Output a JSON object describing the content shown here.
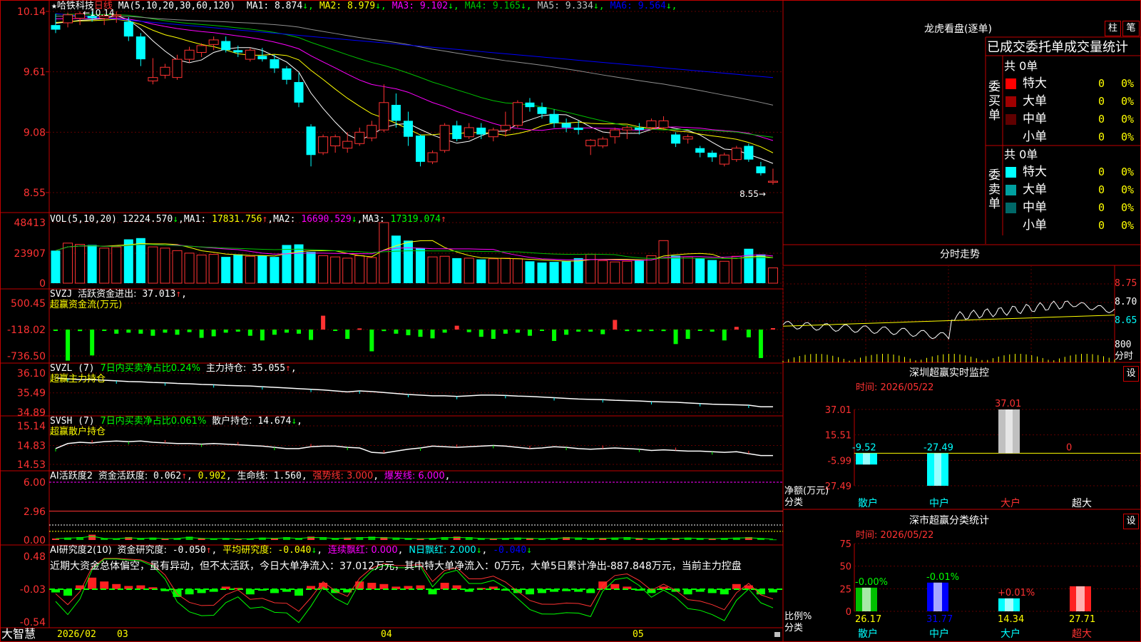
{
  "colors": {
    "up": "#ff3232",
    "down": "#00ffff",
    "frame": "#c00000",
    "ma1": "#ffffff",
    "ma2": "#ffff00",
    "ma3": "#ff00ff",
    "ma4": "#00c000",
    "ma5": "#909090",
    "ma6": "#0000ff"
  },
  "header": {
    "star": "★",
    "stock_name": "哈铁科技",
    "period": "日线",
    "ma_params": "MA(5,10,20,30,60,120)",
    "ma_items": [
      {
        "label": "MA1:",
        "value": "8.874",
        "arrow": "↓",
        "color": "#ffffff"
      },
      {
        "label": "MA2:",
        "value": "8.979",
        "arrow": "↓",
        "color": "#ffff00"
      },
      {
        "label": "MA3:",
        "value": "9.102",
        "arrow": "↓",
        "color": "#ff00ff"
      },
      {
        "label": "MA4:",
        "value": "9.165",
        "arrow": "↓",
        "color": "#00c000"
      },
      {
        "label": "MA5:",
        "value": "9.334",
        "arrow": "↓",
        "color": "#c0c0c0"
      },
      {
        "label": "MA6:",
        "value": "9.564",
        "arrow": "↓",
        "color": "#0000ff"
      }
    ],
    "max_label": "10.14",
    "min_label": "8.55",
    "price_ticks": [
      "10.14",
      "9.61",
      "9.08",
      "8.55"
    ]
  },
  "vol": {
    "title": "VOL(5,10,20)",
    "value": "12224.570",
    "arrow": "↓",
    "ma1": "17831.756",
    "ma1_arrow": "↑",
    "ma2": "16690.529",
    "ma2_arrow": "↓",
    "ma3": "17319.074",
    "ma3_arrow": "↑",
    "ticks": [
      "48413",
      "23907",
      "0"
    ]
  },
  "svzj": {
    "title": "SVZJ",
    "label": "活跃资金进出:",
    "value": "37.013",
    "arrow": "↑",
    "comma": ",",
    "sub": "超赢资金流(万元)",
    "ticks": [
      "500.45",
      "-118.02",
      "-736.50"
    ]
  },
  "svzl": {
    "title": "SVZL (7)",
    "label1": "7日内买卖净占比0.24%",
    "label2": "主力持仓:",
    "value": "35.055",
    "arrow": "↑",
    "comma": ",",
    "sub": "超赢主力持仓",
    "ticks": [
      "36.10",
      "35.49",
      "34.89"
    ]
  },
  "svsh": {
    "title": "SVSH (7)",
    "label1": "7日内买卖净占比0.061%",
    "label2": "散户持仓:",
    "value": "14.674",
    "arrow": "↓",
    "comma": ",",
    "sub": "超赢散户持仓",
    "ticks": [
      "15.14",
      "14.83",
      "14.53"
    ]
  },
  "ai1": {
    "title": "AI活跃度2",
    "label": "资金活跃度:",
    "v1": "0.062",
    "a1": "↑",
    "v2": "0.902",
    "life_label": "生命线:",
    "life": "1.560",
    "strong": "强势线: 3.000",
    "burst": "爆发线: 6.000",
    "ticks": [
      "6.00",
      "2.96",
      "0.00"
    ]
  },
  "ai2": {
    "title": "AI研究度2(10)",
    "label1": "资金研究度:",
    "v1": "-0.050",
    "a1": "↑",
    "label2": "平均研究度:",
    "v2": "-0.040",
    "a2": "↓",
    "label3": "连续飘红: 0.000",
    "label4": "N日飘红: 2.000",
    "a4": "↓",
    "v5": "-0.040",
    "a5": "↓",
    "comment": "近期大资金总体偏空，虽有异动，但不太活跃，今日大单净流入：37.012万元，其中特大单净流入：0万元，大单5日累计净出-887.848万元，当前主力控盘",
    "ticks": [
      "0.48",
      "-0.03",
      "-0.54"
    ]
  },
  "bottom": {
    "brand": "大智慧",
    "dates": [
      "2026/02",
      "03",
      "04",
      "05"
    ]
  },
  "right": {
    "dragon_title": "龙虎看盘(逐单)",
    "btn_bar": "柱",
    "btn_pen": "笔",
    "tabs": "已成交委托单成交量统计",
    "buy_label": "委买单",
    "sell_label": "委卖单",
    "buy_total": "共 0单",
    "sell_total": "共 0单",
    "buy_rows": [
      {
        "name": "特大",
        "count": "0",
        "pct": "0%",
        "color": "#ff0000"
      },
      {
        "name": "大单",
        "count": "0",
        "pct": "0%",
        "color": "#a00000"
      },
      {
        "name": "中单",
        "count": "0",
        "pct": "0%",
        "color": "#600000"
      },
      {
        "name": "小单",
        "count": "0",
        "pct": "0%",
        "color": ""
      }
    ],
    "sell_rows": [
      {
        "name": "特大",
        "count": "0",
        "pct": "0%",
        "color": "#00ffff"
      },
      {
        "name": "大单",
        "count": "0",
        "pct": "0%",
        "color": "#00a0a0"
      },
      {
        "name": "中单",
        "count": "0",
        "pct": "0%",
        "color": "#006868"
      },
      {
        "name": "小单",
        "count": "0",
        "pct": "0%",
        "color": ""
      }
    ],
    "intraday_title": "分时走势",
    "intraday_ticks": [
      "8.75",
      "8.70",
      "8.65"
    ],
    "intraday_vol": "800",
    "intraday_unit": "分时",
    "monitor_title": "深圳超赢实时监控",
    "monitor_time": "时间: 2026/05/22",
    "monitor_btn": "设",
    "monitor_ticks": [
      "37.01",
      "15.51",
      "-5.99",
      "-27.49"
    ],
    "monitor_ylabel": "净额(万元)",
    "monitor_xlabel": "分类",
    "stat_title": "深市超赢分类统计",
    "stat_time": "时间: 2026/05/22",
    "stat_btn": "设",
    "stat_ticks": [
      "75",
      "50",
      "25",
      "0"
    ],
    "stat_ylabel": "比例%",
    "stat_xlabel": "分类"
  },
  "chart_data": [
    {
      "type": "candlestick",
      "title": "哈铁科技 日线",
      "ylim": [
        8.55,
        10.14
      ],
      "min_label": 8.55,
      "max_label": 10.14,
      "ohlc": [
        [
          10.02,
          10.12,
          9.95,
          9.98
        ],
        [
          10.04,
          10.13,
          10.0,
          10.11
        ],
        [
          10.08,
          10.14,
          10.02,
          10.12
        ],
        [
          10.1,
          10.14,
          10.05,
          10.08
        ],
        [
          10.08,
          10.12,
          10.02,
          10.1
        ],
        [
          10.1,
          10.14,
          10.04,
          10.11
        ],
        [
          10.05,
          10.09,
          9.88,
          9.92
        ],
        [
          9.92,
          9.95,
          9.66,
          9.72
        ],
        [
          9.53,
          9.73,
          9.5,
          9.56
        ],
        [
          9.58,
          9.68,
          9.55,
          9.65
        ],
        [
          9.56,
          9.76,
          9.54,
          9.72
        ],
        [
          9.72,
          9.83,
          9.69,
          9.8
        ],
        [
          9.78,
          9.86,
          9.74,
          9.84
        ],
        [
          9.85,
          9.92,
          9.8,
          9.89
        ],
        [
          9.88,
          9.92,
          9.78,
          9.8
        ],
        [
          9.8,
          9.84,
          9.74,
          9.78
        ],
        [
          9.72,
          9.82,
          9.7,
          9.8
        ],
        [
          9.75,
          9.82,
          9.7,
          9.72
        ],
        [
          9.72,
          9.76,
          9.6,
          9.64
        ],
        [
          9.64,
          9.66,
          9.5,
          9.54
        ],
        [
          9.52,
          9.6,
          9.3,
          9.34
        ],
        [
          9.13,
          9.15,
          8.78,
          8.88
        ],
        [
          8.9,
          9.06,
          8.88,
          9.04
        ],
        [
          8.96,
          9.06,
          8.9,
          9.04
        ],
        [
          8.94,
          9.08,
          8.9,
          9.0
        ],
        [
          8.98,
          9.12,
          8.96,
          9.08
        ],
        [
          9.03,
          9.18,
          9.0,
          9.14
        ],
        [
          9.1,
          9.5,
          9.08,
          9.34
        ],
        [
          9.32,
          9.42,
          9.12,
          9.18
        ],
        [
          9.18,
          9.26,
          8.96,
          9.04
        ],
        [
          9.05,
          9.06,
          8.78,
          8.82
        ],
        [
          8.82,
          8.92,
          8.8,
          8.9
        ],
        [
          8.92,
          9.16,
          8.9,
          9.14
        ],
        [
          9.14,
          9.18,
          9.0,
          9.02
        ],
        [
          9.04,
          9.16,
          9.02,
          9.12
        ],
        [
          9.12,
          9.16,
          9.02,
          9.06
        ],
        [
          9.04,
          9.12,
          9.0,
          9.1
        ],
        [
          9.1,
          9.26,
          9.04,
          9.14
        ],
        [
          9.14,
          9.36,
          9.12,
          9.34
        ],
        [
          9.34,
          9.38,
          9.26,
          9.3
        ],
        [
          9.3,
          9.34,
          9.2,
          9.24
        ],
        [
          9.24,
          9.28,
          9.12,
          9.16
        ],
        [
          9.16,
          9.2,
          9.08,
          9.12
        ],
        [
          9.12,
          9.18,
          9.06,
          9.1
        ],
        [
          8.96,
          9.02,
          8.88,
          9.01
        ],
        [
          8.96,
          9.04,
          8.94,
          9.02
        ],
        [
          9.04,
          9.12,
          8.98,
          9.1
        ],
        [
          9.1,
          9.14,
          9.02,
          9.12
        ],
        [
          9.12,
          9.16,
          9.06,
          9.1
        ],
        [
          9.12,
          9.2,
          9.1,
          9.18
        ],
        [
          9.12,
          9.22,
          9.1,
          9.18
        ],
        [
          9.06,
          9.08,
          8.95,
          8.98
        ],
        [
          9.02,
          9.06,
          8.98,
          9.04
        ],
        [
          8.94,
          8.96,
          8.86,
          8.9
        ],
        [
          8.9,
          8.92,
          8.82,
          8.86
        ],
        [
          8.8,
          8.9,
          8.78,
          8.88
        ],
        [
          8.84,
          8.96,
          8.82,
          8.94
        ],
        [
          8.96,
          8.98,
          8.82,
          8.84
        ],
        [
          8.78,
          8.82,
          8.7,
          8.72
        ],
        [
          8.64,
          8.76,
          8.62,
          8.65
        ]
      ]
    },
    {
      "type": "bar",
      "title": "VOL(5,10,20)",
      "ylim": [
        0,
        48413
      ],
      "values": [
        26000,
        32000,
        31000,
        30500,
        28000,
        29000,
        35000,
        36000,
        29000,
        28000,
        26000,
        24000,
        22500,
        23000,
        21000,
        23000,
        21500,
        22000,
        21000,
        30500,
        31000,
        25000,
        22000,
        21000,
        20000,
        22000,
        20500,
        49000,
        38000,
        34000,
        28000,
        21000,
        21500,
        20000,
        20000,
        19000,
        19500,
        20000,
        19500,
        17500,
        16500,
        17000,
        17500,
        20000,
        23000,
        18000,
        17000,
        17500,
        18000,
        22000,
        34000,
        22000,
        21000,
        20000,
        18500,
        17500,
        21500,
        27500,
        23000,
        12224
      ]
    },
    {
      "type": "bar",
      "title": "SVZJ",
      "ylim": [
        -736.5,
        500.45
      ],
      "values": [
        -20,
        -600,
        -30,
        -500,
        -20,
        -80,
        -60,
        -80,
        -120,
        -60,
        -100,
        -50,
        -160,
        -130,
        -60,
        -40,
        -120,
        -210,
        -100,
        -60,
        -80,
        -200,
        360,
        -20,
        -180,
        30,
        -420,
        -30,
        -80,
        -110,
        -140,
        -170,
        -60,
        100,
        -50,
        -140,
        -180,
        -80,
        -60,
        -120,
        -20,
        -220,
        -100,
        -40,
        -40,
        -90,
        250,
        -30,
        -40,
        -30,
        -30,
        -280,
        -180,
        -20,
        -40,
        -210,
        70,
        -150,
        -550,
        37
      ]
    },
    {
      "type": "line",
      "title": "SVZL",
      "ylim": [
        34.89,
        36.1
      ],
      "values": [
        35.95,
        35.92,
        35.9,
        35.9,
        35.88,
        35.86,
        35.84,
        35.83,
        35.81,
        35.8,
        35.78,
        35.77,
        35.75,
        35.74,
        35.72,
        35.71,
        35.7,
        35.68,
        35.66,
        35.64,
        35.62,
        35.6,
        35.58,
        35.55,
        35.52,
        35.55,
        35.53,
        35.5,
        35.47,
        35.44,
        35.42,
        35.4,
        35.4,
        35.38,
        35.4,
        35.42,
        35.42,
        35.41,
        35.39,
        35.38,
        35.36,
        35.34,
        35.32,
        35.3,
        35.29,
        35.28,
        35.26,
        35.25,
        35.24,
        35.22,
        35.21,
        35.2,
        35.18,
        35.16,
        35.14,
        35.13,
        35.12,
        35.11,
        35.06,
        35.06
      ]
    },
    {
      "type": "line",
      "title": "SVSH",
      "ylim": [
        14.53,
        15.14
      ],
      "values": [
        14.78,
        14.86,
        14.88,
        14.87,
        14.89,
        14.9,
        14.89,
        14.9,
        14.88,
        14.87,
        14.86,
        14.86,
        14.85,
        14.86,
        14.85,
        14.84,
        14.83,
        14.82,
        14.8,
        14.78,
        14.78,
        14.81,
        14.82,
        14.82,
        14.8,
        14.79,
        14.72,
        14.71,
        14.74,
        14.77,
        14.79,
        14.82,
        14.81,
        14.8,
        14.81,
        14.82,
        14.83,
        14.82,
        14.8,
        14.78,
        14.79,
        14.81,
        14.8,
        14.78,
        14.77,
        14.78,
        14.79,
        14.78,
        14.77,
        14.75,
        14.76,
        14.75,
        14.74,
        14.74,
        14.73,
        14.72,
        14.73,
        14.7,
        14.67,
        14.67
      ]
    },
    {
      "type": "line",
      "title": "AI活跃度2",
      "ylim": [
        0,
        6
      ],
      "values": [
        0.15,
        0.25,
        0.3,
        0.55,
        0.2,
        0.15,
        0.3,
        0.2,
        0.25,
        0.15,
        0.2,
        0.35,
        0.2,
        0.15,
        0.2,
        0.1,
        0.15,
        0.25,
        0.2,
        0.3,
        0.2,
        0.35,
        0.3,
        0.2,
        0.25,
        0.3,
        0.35,
        0.3,
        0.25,
        0.2,
        0.15,
        0.2,
        0.3,
        0.35,
        0.3,
        0.2,
        0.15,
        0.2,
        0.25,
        0.2,
        0.15,
        0.2,
        0.3,
        0.25,
        0.2,
        0.2,
        0.25,
        0.3,
        0.2,
        0.15,
        0.2,
        0.2,
        0.25,
        0.2,
        0.15,
        0.2,
        0.25,
        0.3,
        0.2,
        0.06
      ]
    },
    {
      "type": "bar",
      "title": "AI研究度2(10)",
      "ylim": [
        -0.54,
        0.48
      ],
      "values": [
        -0.05,
        -0.1,
        0.06,
        0.18,
        0.12,
        0.08,
        0.05,
        0.06,
        0.03,
        -0.03,
        -0.12,
        -0.08,
        -0.06,
        -0.04,
        0.04,
        0.02,
        -0.08,
        -0.02,
        -0.06,
        -0.04,
        -0.1,
        0.05,
        0.1,
        -0.06,
        -0.05,
        0.12,
        0.1,
        0.08,
        0.04,
        0.05,
        0.06,
        -0.08,
        0.1,
        0.06,
        -0.04,
        0.02,
        0.04,
        -0.02,
        -0.06,
        -0.08,
        -0.06,
        -0.04,
        -0.03,
        -0.04,
        -0.06,
        0.12,
        0.08,
        0.04,
        -0.02,
        -0.06,
        0.04,
        -0.04,
        -0.08,
        -0.04,
        -0.06,
        -0.08,
        0.08,
        0.06,
        -0.08,
        -0.05
      ]
    },
    {
      "type": "bar",
      "title": "深圳超赢实时监控",
      "categories": [
        "散户",
        "中户",
        "大户",
        "超大"
      ],
      "values": [
        -9.52,
        -27.49,
        37.01,
        0
      ],
      "ylim": [
        -27.49,
        37.01
      ]
    },
    {
      "type": "bar",
      "title": "深市超赢分类统计",
      "categories": [
        "散户",
        "中户",
        "大户",
        "超大"
      ],
      "values": [
        26.17,
        31.77,
        14.34,
        27.71
      ],
      "change": [
        "-0.00%",
        "-0.01%",
        "+0.01%",
        ""
      ],
      "ylim": [
        0,
        75
      ]
    }
  ]
}
